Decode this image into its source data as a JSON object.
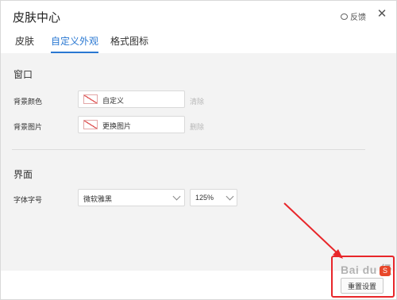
{
  "window": {
    "title": "皮肤中心",
    "feedback_label": "反馈",
    "close_glyph": "✕"
  },
  "tabs": [
    {
      "label": "皮肤",
      "active": false
    },
    {
      "label": "自定义外观",
      "active": true
    },
    {
      "label": "格式图标",
      "active": false
    }
  ],
  "window_section": {
    "title": "窗口",
    "background_color": {
      "label": "背景颜色",
      "value": "自定义",
      "clear_label": "清除"
    },
    "background_image": {
      "label": "背景图片",
      "value": "更换图片",
      "clear_label": "删除"
    }
  },
  "interface_section": {
    "title": "界面",
    "font": {
      "label": "字体字号",
      "family_value": "微软雅黑",
      "size_value": "125%"
    }
  },
  "footer": {
    "reset_label": "重置设置"
  },
  "overlay": {
    "watermark_text": "Bai du 经验",
    "badge_glyph": "S",
    "annotation_color": "#e8262a"
  },
  "colors": {
    "accent": "#2a78d2",
    "panel_bg": "#f3f3f3"
  }
}
